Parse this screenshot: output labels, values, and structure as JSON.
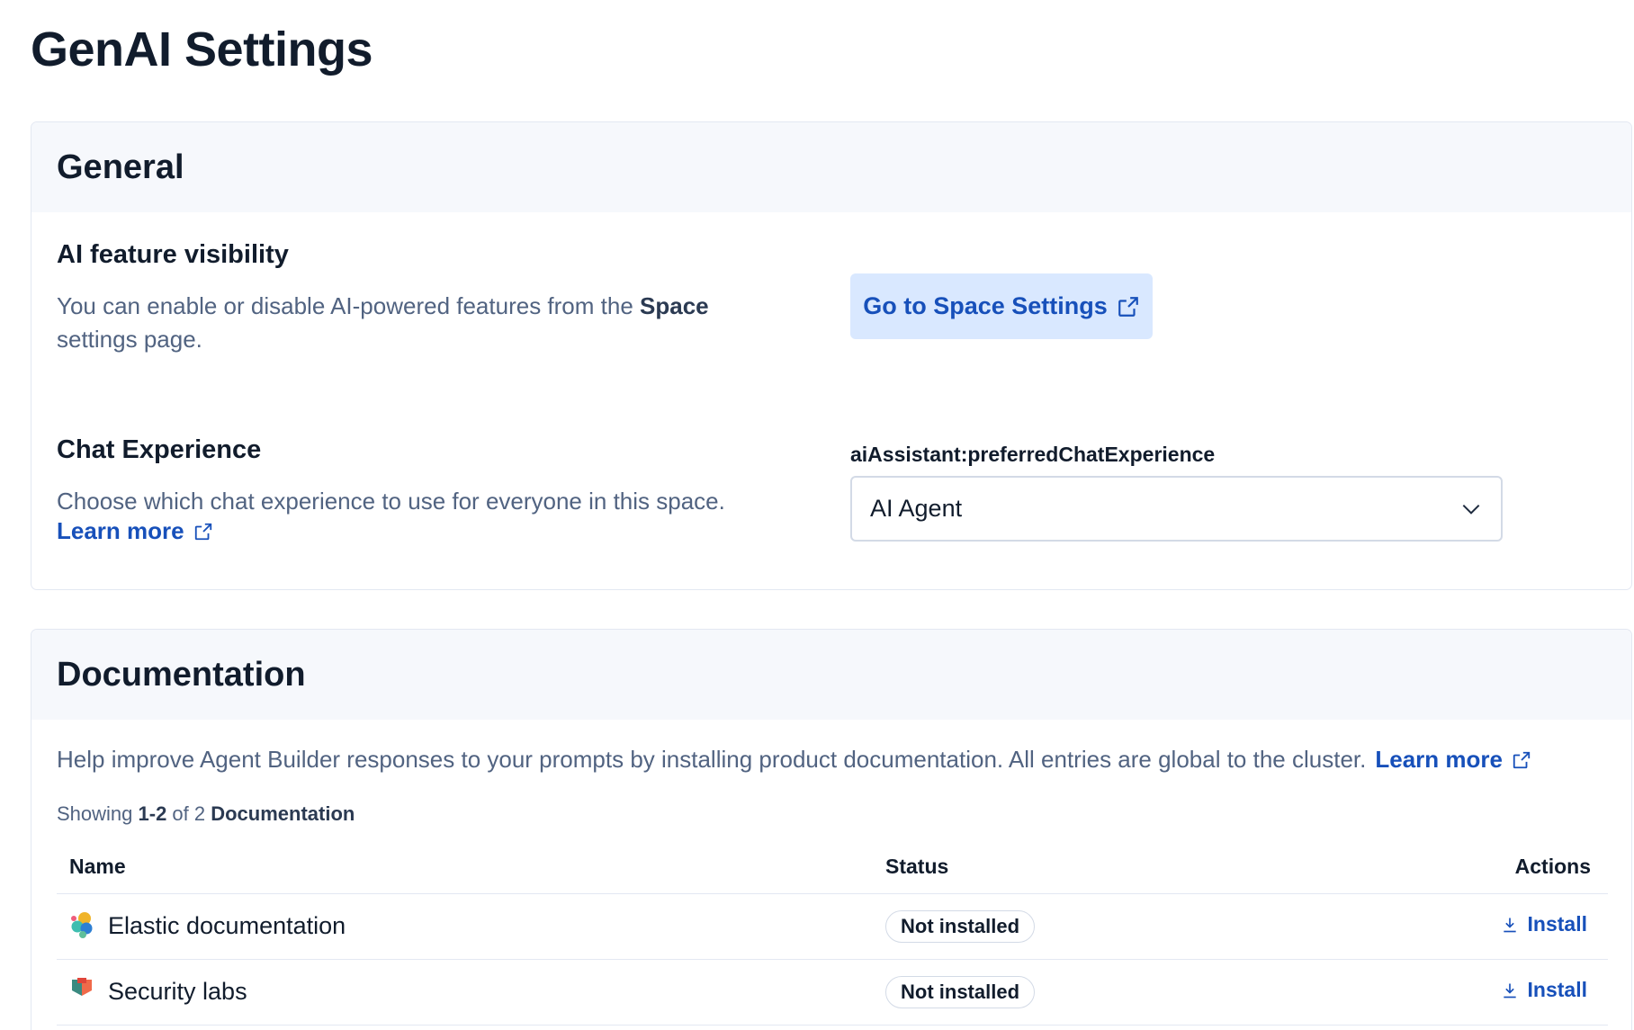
{
  "page": {
    "title": "GenAI Settings"
  },
  "general": {
    "heading": "General",
    "ai_visibility": {
      "title": "AI feature visibility",
      "desc_prefix": "You can enable or disable AI-powered features from the ",
      "desc_bold": "Space",
      "desc_suffix": "settings page.",
      "button_label": "Go to Space Settings"
    },
    "chat_experience": {
      "title": "Chat Experience",
      "desc": "Choose which chat experience to use for everyone in this space.",
      "learn_more": "Learn more",
      "field_label": "aiAssistant:preferredChatExperience",
      "selected_value": "AI Agent"
    }
  },
  "documentation": {
    "heading": "Documentation",
    "desc": "Help improve Agent Builder responses to your prompts by installing product documentation. All entries are global to the cluster.",
    "learn_more": "Learn more",
    "showing_prefix": "Showing ",
    "showing_range": "1-2",
    "showing_mid": " of 2 ",
    "showing_suffix": "Documentation",
    "columns": {
      "name": "Name",
      "status": "Status",
      "actions": "Actions"
    },
    "rows": [
      {
        "name": "Elastic documentation",
        "icon": "elastic-logo-icon",
        "status": "Not installed",
        "action": "Install"
      },
      {
        "name": "Security labs",
        "icon": "security-labs-logo-icon",
        "status": "Not installed",
        "action": "Install"
      }
    ]
  },
  "colors": {
    "accent": "#1750ba",
    "button_bg": "#d9e8ff",
    "panel_head_bg": "#f6f8fc"
  }
}
